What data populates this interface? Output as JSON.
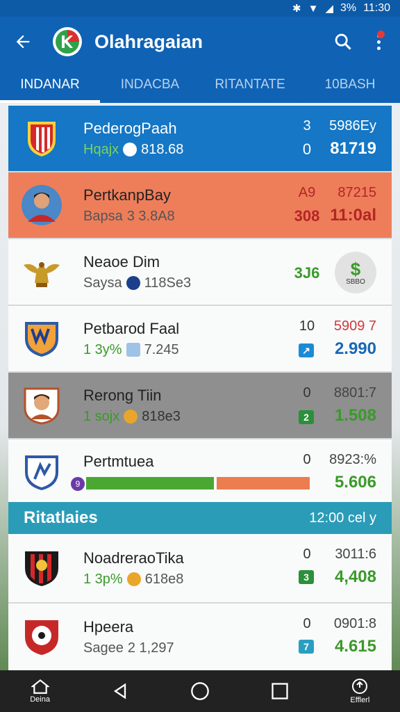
{
  "status": {
    "time": "11:30",
    "battery": "3%"
  },
  "appbar": {
    "title": "Olahragaian"
  },
  "tabs": [
    {
      "label": "INDANAR",
      "active": true
    },
    {
      "label": "INDACBA",
      "active": false
    },
    {
      "label": "RITANTATE",
      "active": false
    },
    {
      "label": "10BASH",
      "active": false
    }
  ],
  "rows": [
    {
      "name": "PederogPaah",
      "sub": "Hqajx",
      "sub_value": "818.68",
      "num1": "3",
      "num2": "0",
      "val1": "5986Ey",
      "val2": "81719"
    },
    {
      "name": "PertkanpBay",
      "sub": "Bapsa",
      "sub_value": "3 3.8A8",
      "num1": "A9",
      "num2": "308",
      "val1": "87215",
      "val2": "11:0al"
    },
    {
      "name": "Neaoe Dim",
      "sub": "Saysa",
      "sub_value": "118Se3",
      "num2": "3J6",
      "badge": "$",
      "badge_text": "SBBO"
    },
    {
      "name": "Petbarod Faal",
      "sub": "1 3y%",
      "sub_value": "7.245",
      "num1": "10",
      "val1": "5909 7",
      "val2": "2.990"
    },
    {
      "name": "Rerong Tiin",
      "sub": "1 sojx",
      "sub_value": "818e3",
      "num1": "0",
      "val1": "8801:7",
      "val2": "1.508",
      "square": "2"
    },
    {
      "name": "Pertmtuea",
      "num1": "0",
      "val1": "8923:%",
      "val2": "5.606",
      "bar_green": 0.58,
      "bar_orange": 0.42,
      "bar_badge": "9"
    }
  ],
  "section": {
    "title": "Ritatlaies",
    "right": "12:00 cel y"
  },
  "rows2": [
    {
      "name": "NoadreraoTika",
      "sub": "1 3p%",
      "sub_value": "618e8",
      "num1": "0",
      "val1": "3011:6",
      "val2": "4,408",
      "square": "3"
    },
    {
      "name": "Hpeera",
      "sub": "Sagee",
      "sub_value": "2 1,297",
      "num1": "0",
      "val1": "0901:8",
      "val2": "4.615",
      "square": "7"
    }
  ],
  "navbar": {
    "home_label": "Deina",
    "event_label": "Efflerl"
  },
  "colors": {
    "primary": "#0f62b4",
    "green": "#3a9a2a",
    "red": "#d03a3a",
    "blue": "#1a67b8"
  }
}
